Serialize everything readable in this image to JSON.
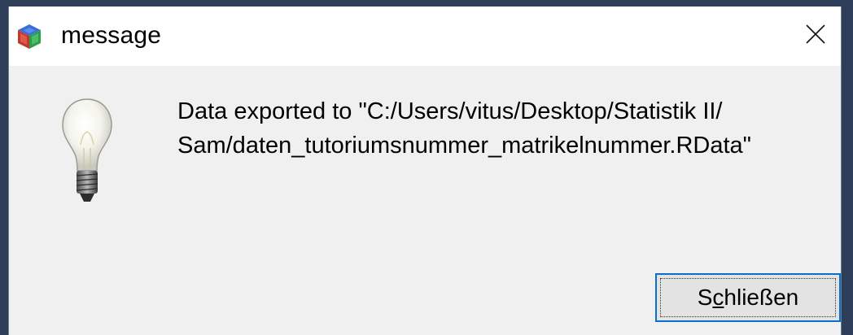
{
  "window": {
    "title": "message",
    "app_icon": "tk-feather-cube-icon",
    "close_icon": "close-icon"
  },
  "message": {
    "icon": "lightbulb-icon",
    "line1": "Data exported to \"C:/Users/vitus/Desktop/Statistik II/",
    "line2": "Sam/daten_tutoriumsnummer_matrikelnummer.RData\""
  },
  "buttons": {
    "ok_label_pre": "S",
    "ok_label_mnemonic": "c",
    "ok_label_post": "hließen"
  },
  "colors": {
    "focus_border": "#0a6fcc",
    "dialog_bg": "#f0f0f0",
    "titlebar_bg": "#ffffff"
  }
}
